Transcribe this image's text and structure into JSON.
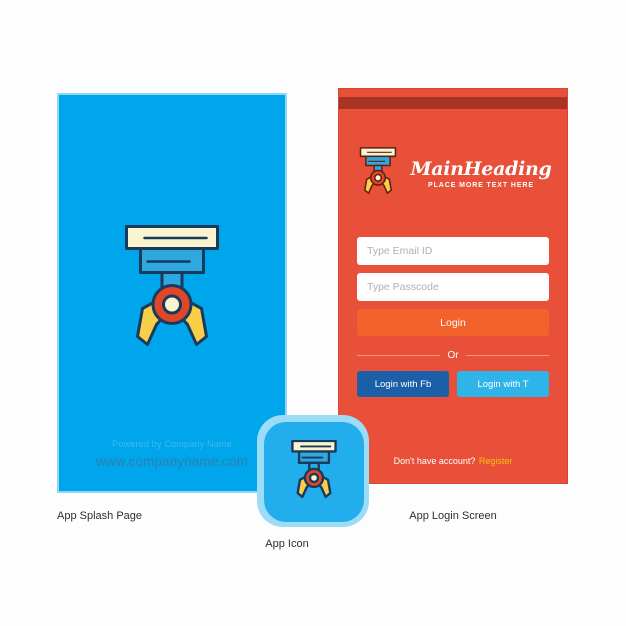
{
  "splash": {
    "icon_name": "robot-claw-icon",
    "powered_by": "Powered by Company Name",
    "website": "www.companyname.com",
    "caption": "App Splash Page",
    "background_color": "#00A6EB"
  },
  "app_icon": {
    "icon_name": "robot-claw-icon",
    "caption": "App Icon",
    "background_color": "#22AEEC"
  },
  "login": {
    "background_color": "#E8503A",
    "statusbar_color": "#A93426",
    "brand": {
      "icon_name": "robot-claw-icon",
      "main_heading": "MainHeading",
      "sub_heading": "PLACE MORE TEXT HERE"
    },
    "fields": {
      "email_placeholder": "Type Email ID",
      "email_value": "",
      "passcode_placeholder": "Type Passcode",
      "passcode_value": ""
    },
    "submit_label": "Login",
    "submit_color": "#F2622A",
    "or_label": "Or",
    "social": [
      {
        "label": "Login with Fb",
        "color": "#1B5FA9"
      },
      {
        "label": "Login with T",
        "color": "#2FB4E9"
      }
    ],
    "register_prompt": "Don't have account?",
    "register_link": "Register",
    "register_link_color": "#FFC107",
    "caption": "App Login Screen"
  }
}
